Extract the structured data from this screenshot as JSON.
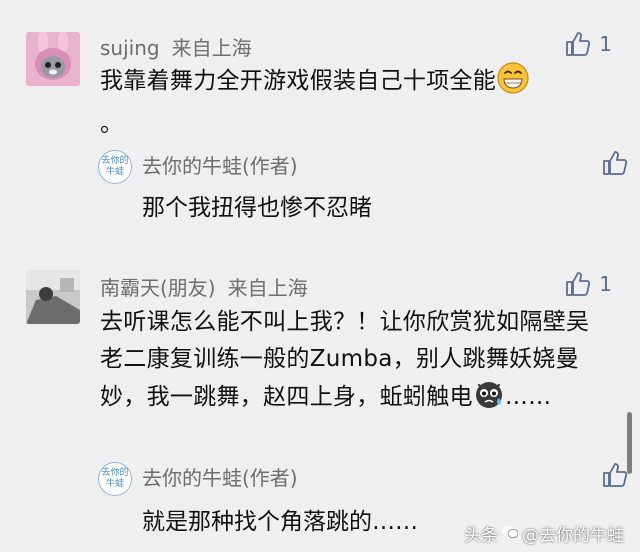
{
  "comments": [
    {
      "user": "sujing",
      "location": "来自上海",
      "text": "我靠着舞力全开游戏假装自己十项全能",
      "text_tail": "。",
      "emoji": "grinning-emoji",
      "likes": "1",
      "reply": {
        "avatar_text": "去你的牛蛙",
        "author": "去你的牛蛙(作者)",
        "text": "那个我扭得也惨不忍睹"
      }
    },
    {
      "user": "南霸天(朋友)",
      "location": "来自上海",
      "text": "去听课怎么能不叫上我？！让你欣赏犹如隔壁吴老二康复训练一般的Zumba，别人跳舞妖娆曼妙，我一跳舞，赵四上身，蚯蚓触电",
      "text_tail": "……",
      "emoji": "crying-face-emoji",
      "likes": "1",
      "reply": {
        "avatar_text": "去你的牛蛙",
        "author": "去你的牛蛙(作者)",
        "text": "就是那种找个角落跳的……"
      }
    }
  ],
  "watermark": {
    "prefix": "头条",
    "account": "@去你的牛蛙"
  },
  "colors": {
    "background": "#efefef",
    "like_icon": "#5b6d8c",
    "reply_avatar": "#4a86c5"
  }
}
